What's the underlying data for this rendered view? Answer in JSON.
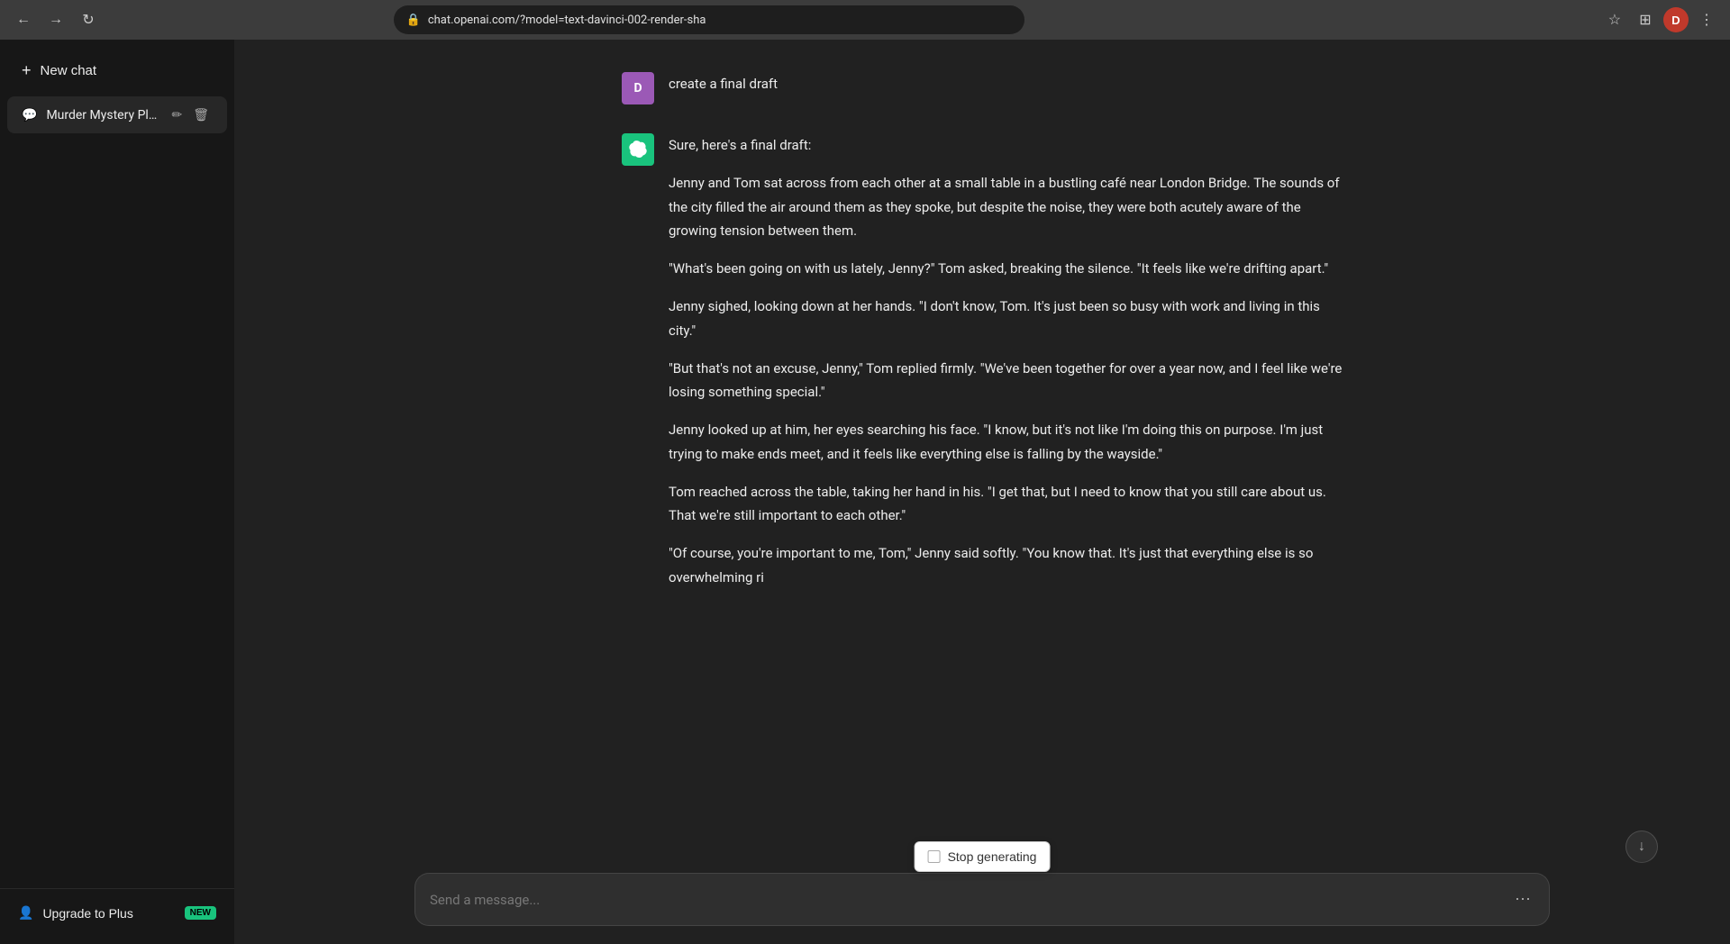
{
  "browser": {
    "url": "chat.openai.com/?model=text-davinci-002-render-sha",
    "avatar_initial": "D"
  },
  "sidebar": {
    "new_chat_label": "New chat",
    "chat_items": [
      {
        "id": "murder-mystery",
        "title": "Murder Mystery Plot."
      }
    ],
    "upgrade": {
      "label": "Upgrade to Plus",
      "badge": "NEW"
    }
  },
  "messages": [
    {
      "role": "user",
      "avatar": "D",
      "text": "create a final draft"
    },
    {
      "role": "assistant",
      "intro": "Sure, here's a final draft:",
      "paragraphs": [
        "Jenny and Tom sat across from each other at a small table in a bustling café near London Bridge. The sounds of the city filled the air around them as they spoke, but despite the noise, they were both acutely aware of the growing tension between them.",
        "\"What's been going on with us lately, Jenny?\" Tom asked, breaking the silence. \"It feels like we're drifting apart.\"",
        "Jenny sighed, looking down at her hands. \"I don't know, Tom. It's just been so busy with work and living in this city.\"",
        "\"But that's not an excuse, Jenny,\" Tom replied firmly. \"We've been together for over a year now, and I feel like we're losing something special.\"",
        "Jenny looked up at him, her eyes searching his face. \"I know, but it's not like I'm doing this on purpose. I'm just trying to make ends meet, and it feels like everything else is falling by the wayside.\"",
        "Tom reached across the table, taking her hand in his. \"I get that, but I need to know that you still care about us. That we're still important to each other.\"",
        "\"Of course, you're important to me, Tom,\" Jenny said softly. \"You know that. It's just that everything else is so overwhelming ri"
      ]
    }
  ],
  "input": {
    "placeholder": "Send a message..."
  },
  "stop_generating": {
    "label": "Stop generating"
  }
}
